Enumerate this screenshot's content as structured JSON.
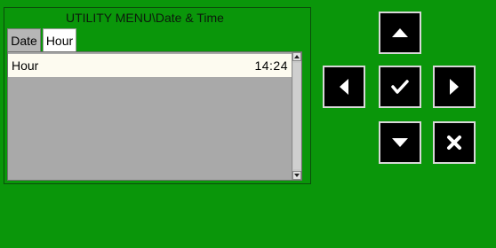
{
  "header": {
    "title": "UTILITY MENU\\Date & Time"
  },
  "tabs": [
    {
      "label": "Date",
      "active": false
    },
    {
      "label": "Hour",
      "active": true
    }
  ],
  "list": {
    "rows": [
      {
        "label": "Hour",
        "value": "14:24"
      }
    ]
  },
  "keypad": {
    "up_icon": "arrow-up-icon",
    "left_icon": "arrow-left-icon",
    "ok_icon": "checkmark-icon",
    "right_icon": "arrow-right-icon",
    "down_icon": "arrow-down-icon",
    "cancel_icon": "cancel-x-icon"
  },
  "colors": {
    "background": "#0a960a",
    "list_background": "#a9a9a9",
    "selected_row": "#fdfbf0",
    "key_background": "#000000"
  }
}
